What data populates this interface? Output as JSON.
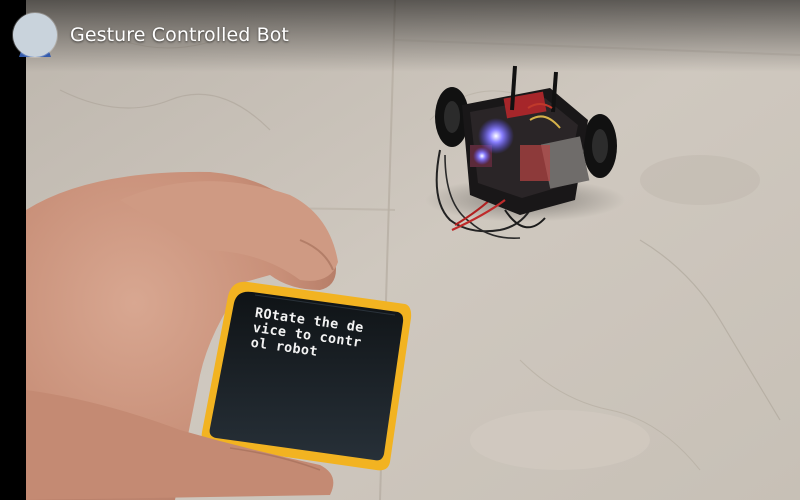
{
  "video": {
    "title": "Gesture Controlled Bot",
    "channel_avatar": "channel-avatar"
  },
  "device_screen": {
    "lines": [
      "ROtate the de",
      "vice to contr",
      "ol robot"
    ]
  },
  "colors": {
    "floor": "#c9c2b8",
    "device_frame": "#f2b321",
    "device_screen": "#1c2226",
    "robot_body": "#191718",
    "robot_led": "#5a4dff"
  }
}
